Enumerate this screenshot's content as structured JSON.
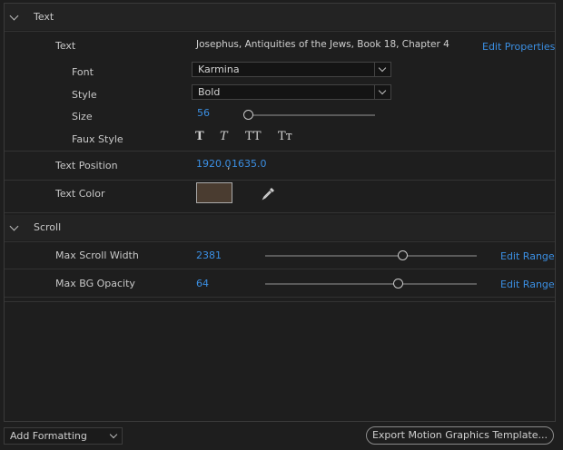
{
  "text_section": {
    "header": "Text",
    "text_label": "Text",
    "text_value": "Josephus, Antiquities of the Jews, Book 18, Chapter 4",
    "edit_properties": "Edit Properties",
    "font_label": "Font",
    "font_value": "Karmina",
    "style_label": "Style",
    "style_value": "Bold",
    "size_label": "Size",
    "size_value": "56",
    "size_slider_fraction": 0.0,
    "faux_style_label": "Faux Style",
    "faux_buttons": [
      "T",
      "T",
      "TT",
      "Tт"
    ],
    "text_position_label": "Text Position",
    "text_position_x": "1920.0",
    "text_position_sep": ",",
    "text_position_y": "1635.0",
    "text_color_label": "Text Color",
    "text_color": "#4a3c30"
  },
  "scroll_section": {
    "header": "Scroll",
    "max_scroll_width_label": "Max Scroll Width",
    "max_scroll_width_value": "2381",
    "max_scroll_width_fraction": 0.65,
    "max_bg_opacity_label": "Max BG Opacity",
    "max_bg_opacity_value": "64",
    "max_bg_opacity_fraction": 0.63,
    "edit_range": "Edit Range"
  },
  "footer": {
    "add_formatting": "Add Formatting",
    "export_button": "Export Motion Graphics Template..."
  },
  "colors": {
    "accent": "#3b8fe3",
    "background": "#1e1e1e"
  }
}
